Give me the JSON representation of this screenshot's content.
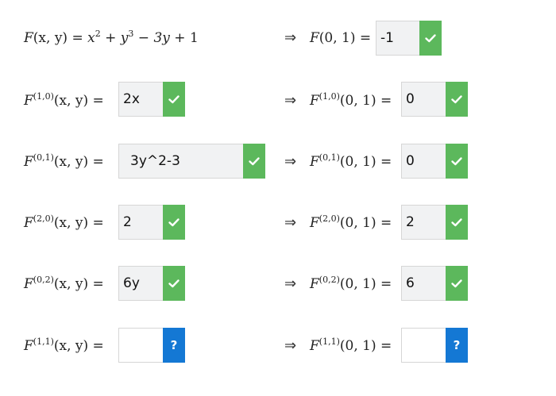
{
  "colors": {
    "correct": "#5cb85c",
    "unanswered": "#1478d4"
  },
  "main_function": {
    "lhs_func": "F",
    "lhs_args": "(x, y)",
    "eq": "=",
    "x": "x",
    "x_exp": "2",
    "plus1": "+",
    "y": "y",
    "y_exp": "3",
    "minus": "−",
    "term3": "3y",
    "plus2": "+",
    "const": "1"
  },
  "arrow_symbol": "⇒",
  "eval_point": "(0, 1)",
  "value_args": "(x, y)",
  "rows": [
    {
      "id": "main",
      "lhs_sup": "",
      "rhs_sup": "",
      "deriv_answer": null,
      "deriv_status": null,
      "value_answer": "-1",
      "value_status": "correct"
    },
    {
      "id": "d10",
      "lhs_sup": "(1,0)",
      "rhs_sup": "(1,0)",
      "deriv_answer": "2x",
      "deriv_status": "correct",
      "value_answer": "0",
      "value_status": "correct"
    },
    {
      "id": "d01",
      "lhs_sup": "(0,1)",
      "rhs_sup": "(0,1)",
      "deriv_answer": "3y^2-3",
      "deriv_status": "correct",
      "value_answer": "0",
      "value_status": "correct"
    },
    {
      "id": "d20",
      "lhs_sup": "(2,0)",
      "rhs_sup": "(2,0)",
      "deriv_answer": "2",
      "deriv_status": "correct",
      "value_answer": "2",
      "value_status": "correct"
    },
    {
      "id": "d02",
      "lhs_sup": "(0,2)",
      "rhs_sup": "(0,2)",
      "deriv_answer": "6y",
      "deriv_status": "correct",
      "value_answer": "6",
      "value_status": "correct"
    },
    {
      "id": "d11",
      "lhs_sup": "(1,1)",
      "rhs_sup": "(1,1)",
      "deriv_answer": "",
      "deriv_status": "unanswered",
      "value_answer": "",
      "value_status": "unanswered"
    }
  ],
  "icons": {
    "correct": "checkmark-icon",
    "unanswered": "question-mark-icon"
  },
  "unanswered_symbol": "?",
  "func_letter": "F",
  "eq_sign": "="
}
